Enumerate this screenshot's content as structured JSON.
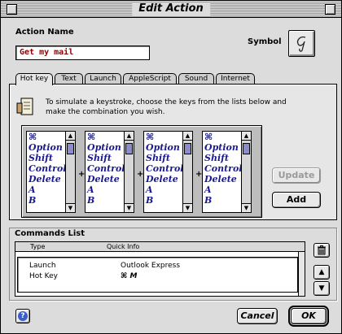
{
  "window": {
    "title": "Edit Action"
  },
  "action": {
    "name_label": "Action Name",
    "name_value": "Get my mail",
    "symbol_label": "Symbol"
  },
  "tabs": [
    {
      "label": "Hot key",
      "active": true
    },
    {
      "label": "Text"
    },
    {
      "label": "Launch"
    },
    {
      "label": "AppleScript"
    },
    {
      "label": "Sound"
    },
    {
      "label": "Internet"
    }
  ],
  "hotkey": {
    "hint": "To simulate a keystroke, choose the keys from the lists below and make the combination you wish.",
    "list_items": [
      "⌘",
      "Option",
      "Shift",
      "Control",
      "Delete",
      "A",
      "B"
    ],
    "plus": "+"
  },
  "buttons": {
    "update": "Update",
    "add": "Add",
    "cancel": "Cancel",
    "ok": "OK",
    "help": "?"
  },
  "commands": {
    "title": "Commands List",
    "columns": [
      "Type",
      "Quick Info"
    ],
    "rows": [
      {
        "type": "Launch",
        "info": "Outlook Express"
      },
      {
        "type": "Hot Key",
        "info": "⌘ M"
      }
    ]
  }
}
